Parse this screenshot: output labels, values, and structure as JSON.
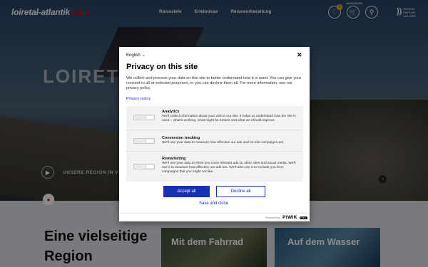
{
  "site": {
    "logo_name": "loiretal-atlantik",
    "logo_tld": ".com",
    "nav": [
      "Reiseziele",
      "Erlebnisse",
      "Reisevorbereitung"
    ],
    "favorites_count": "0",
    "cart_label": "WARENKORB",
    "brand_line1": "REGION",
    "brand_line2": "PAYS DE",
    "brand_line3": "LA LOIRE",
    "hero_title": "LOIRETAL",
    "hero_label": "UNSERE REGION IN V",
    "section_heading_line1": "Eine vielseitige",
    "section_heading_line2": "Region",
    "card1": "Mit dem Fahrrad",
    "card2": "Auf dem Wasser"
  },
  "consent": {
    "language": "English",
    "title": "Privacy on this site",
    "description": "We collect and process your data on this site to better understand how it is used. You can give your consent to all or selected purposes, or you can decline them all. For more information, see our privacy policy.",
    "privacy_link": "Privacy policy",
    "categories": [
      {
        "name": "Analytics",
        "description": "We'll collect information about your visit to our site. It helps us understand how the site is used – what's working, what might be broken and what we should improve.",
        "enabled": false
      },
      {
        "name": "Conversion tracking",
        "description": "We'll use your data to measure how effective our ads and on-site campaigns are.",
        "enabled": false
      },
      {
        "name": "Remarketing",
        "description": "We'll use your data to show you more relevant ads on other sites and social media. We'll use it to measure how effective our ads are. We'll also use it to exclude you from campaigns that you might not like.",
        "enabled": false
      }
    ],
    "accept_all": "Accept all",
    "decline_all": "Decline all",
    "save_close": "Save and close",
    "powered_by": "Powered by",
    "vendor": "PIWIK",
    "vendor_tag": "PRO"
  },
  "colors": {
    "accent_blue": "#1731b7",
    "logo_red": "#e2001a",
    "badge_yellow": "#f2b400"
  },
  "icons": [
    "heart-icon",
    "cart-icon",
    "search-icon",
    "play-icon",
    "chevron-right-icon",
    "map-pin-icon",
    "close-icon",
    "chevron-down-icon"
  ]
}
